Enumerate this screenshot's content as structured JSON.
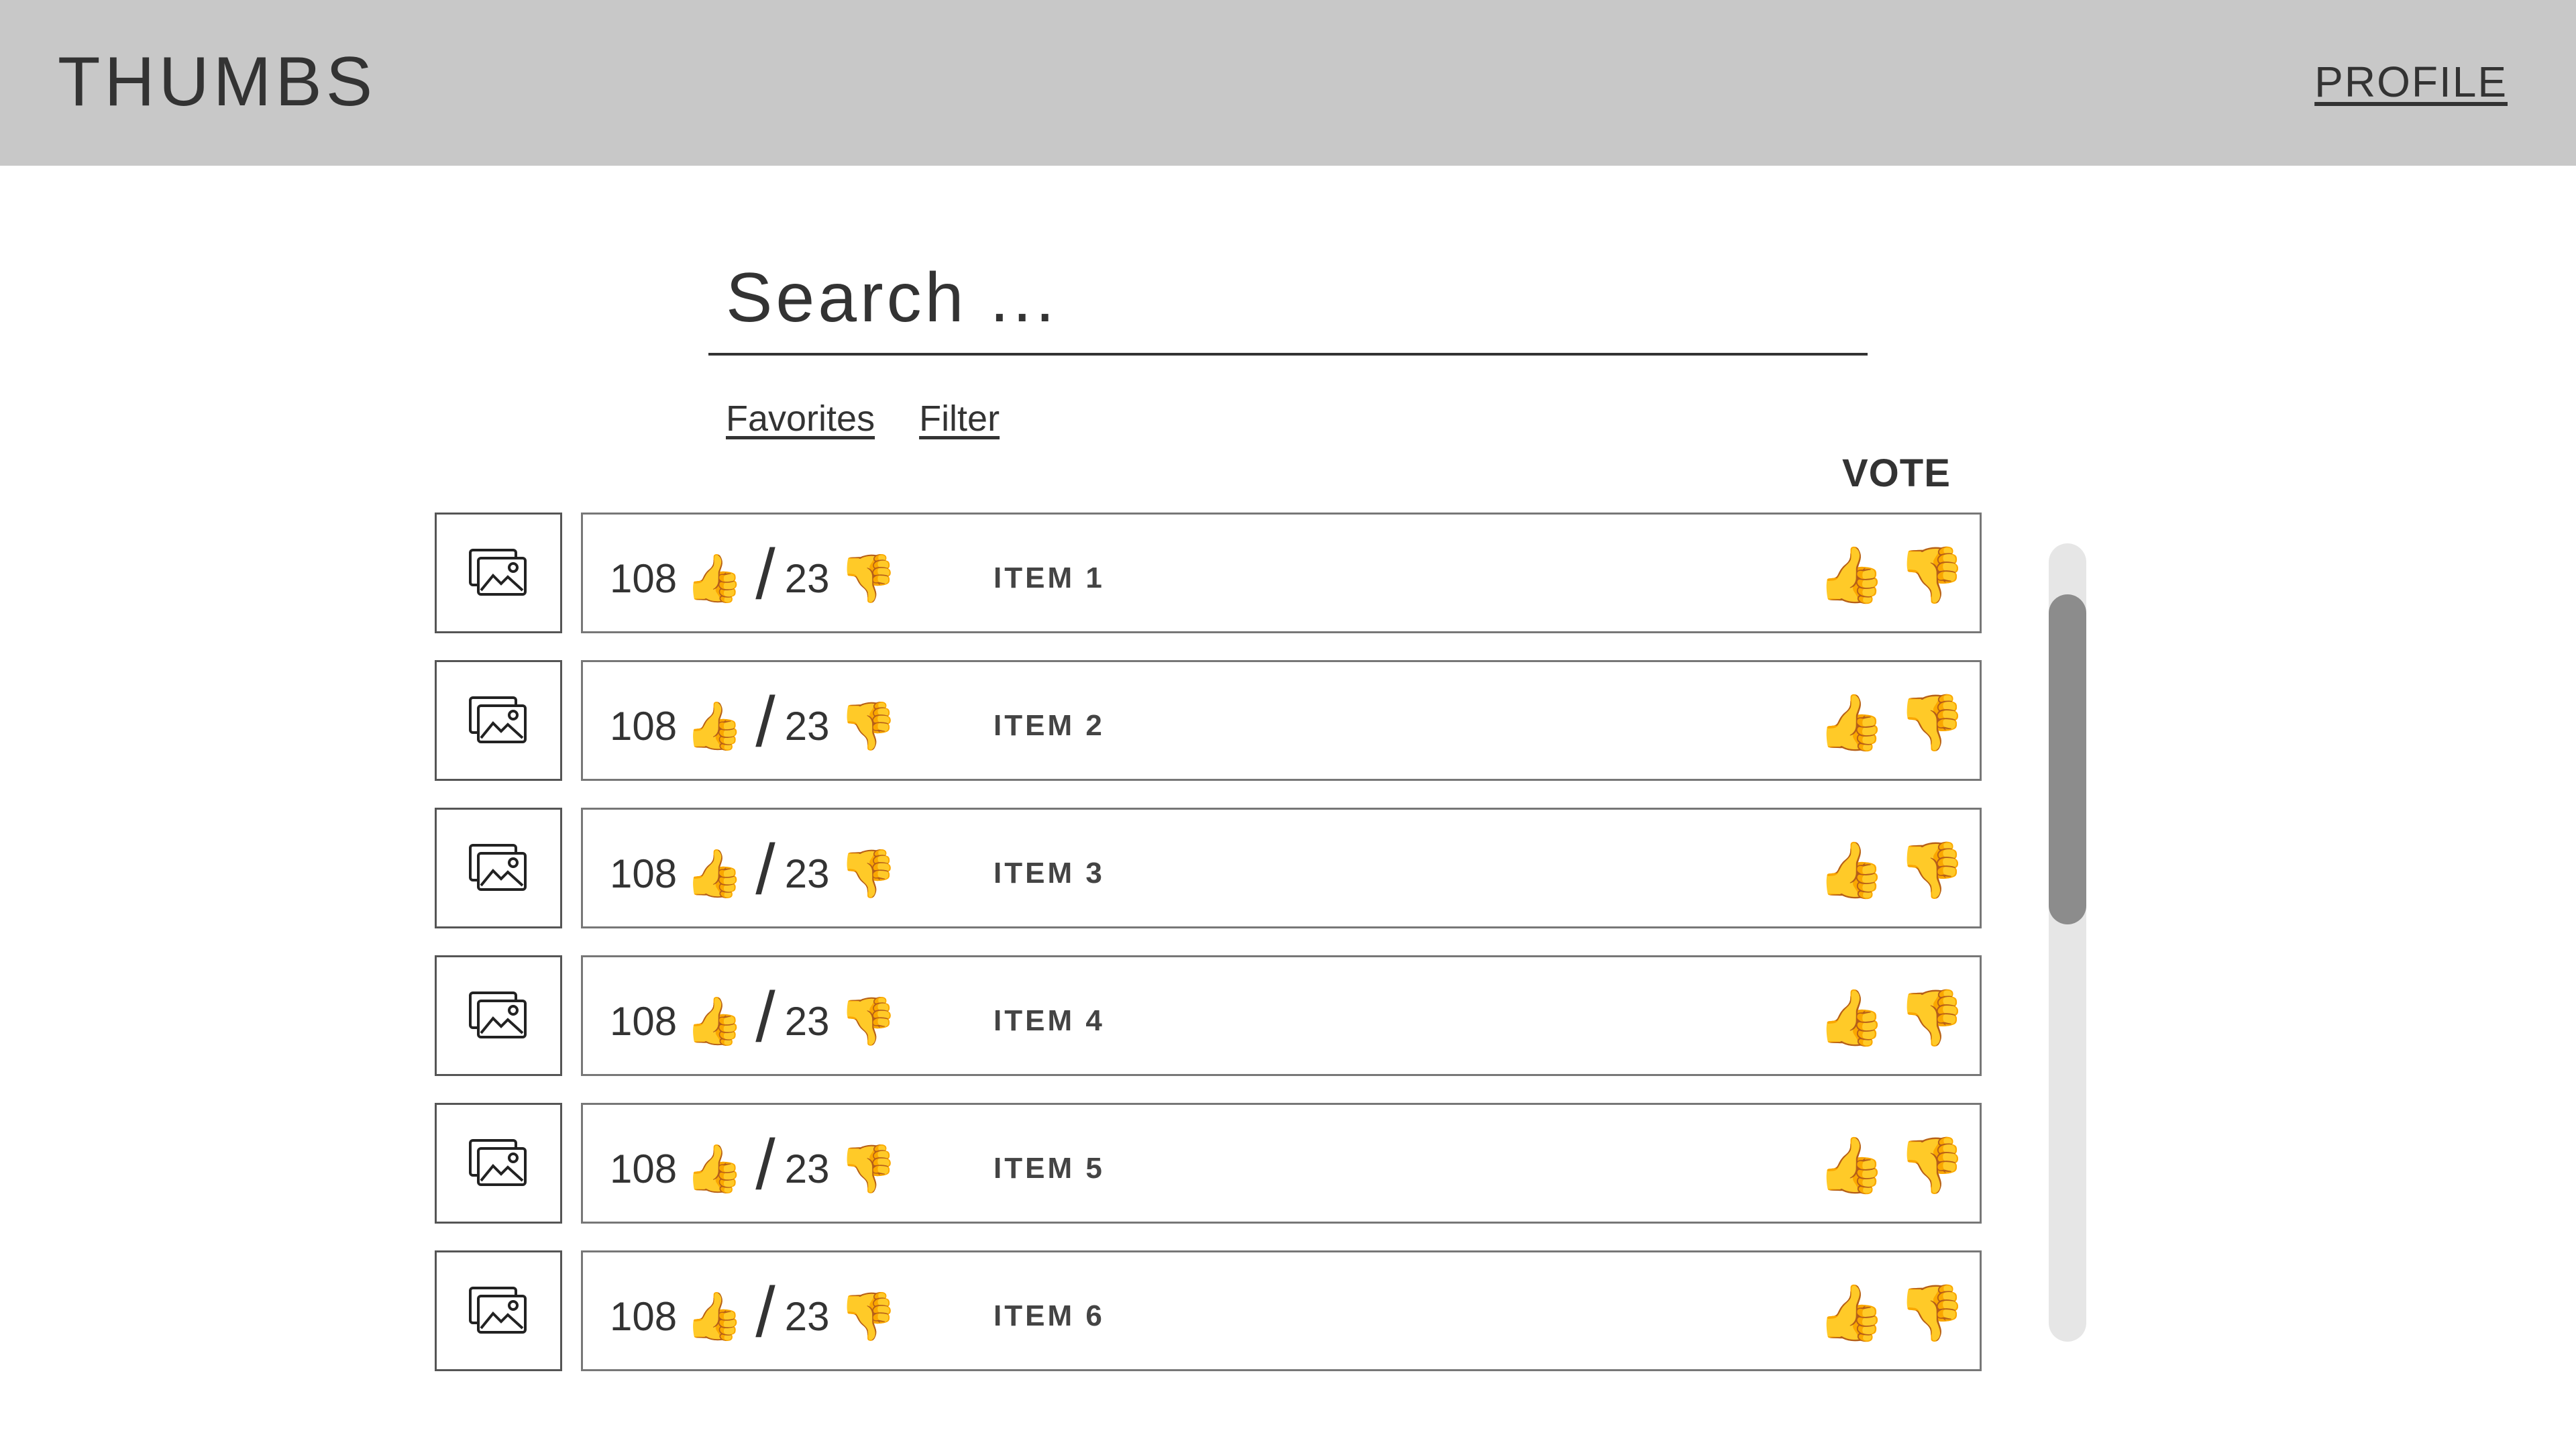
{
  "header": {
    "app_title": "THUMBS",
    "profile_label": "PROFILE"
  },
  "search": {
    "placeholder": "Search ..."
  },
  "links": {
    "favorites": "Favorites",
    "filter": "Filter"
  },
  "list": {
    "vote_header": "VOTE",
    "items": [
      {
        "up_count": "108",
        "down_count": "23",
        "name": "ITEM 1"
      },
      {
        "up_count": "108",
        "down_count": "23",
        "name": "ITEM 2"
      },
      {
        "up_count": "108",
        "down_count": "23",
        "name": "ITEM 3"
      },
      {
        "up_count": "108",
        "down_count": "23",
        "name": "ITEM 4"
      },
      {
        "up_count": "108",
        "down_count": "23",
        "name": "ITEM 5"
      },
      {
        "up_count": "108",
        "down_count": "23",
        "name": "ITEM 6"
      }
    ]
  },
  "icons": {
    "thumbs_up": "👍",
    "thumbs_down": "👎",
    "slash": "/"
  },
  "colors": {
    "header_bg": "#c8c8c8",
    "text": "#333333",
    "scroll_track": "#e6e6e6",
    "scroll_thumb": "#8c8c8c"
  }
}
